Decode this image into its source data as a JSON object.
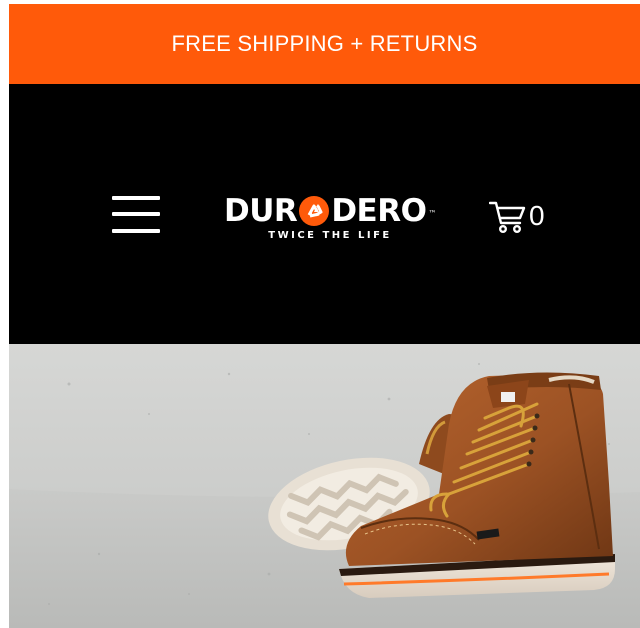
{
  "colors": {
    "promo_bg": "#FF5A0A",
    "header_bg": "#000000",
    "logo_accent": "#FF5A0A",
    "boot_leather": "#A45A2A",
    "wall": "#CFCFCD"
  },
  "promo": {
    "text": "FREE SHIPPING + RETURNS"
  },
  "header": {
    "menu_icon": "hamburger-menu-icon",
    "logo": {
      "word_before": "DUR",
      "word_after": "DERO",
      "trademark": "™",
      "tagline": "TWICE THE LIFE",
      "icon": "recycle-icon"
    },
    "cart": {
      "icon": "shopping-cart-icon",
      "count": "0"
    }
  },
  "hero": {
    "image": "brown-leather-work-boot-photo"
  }
}
